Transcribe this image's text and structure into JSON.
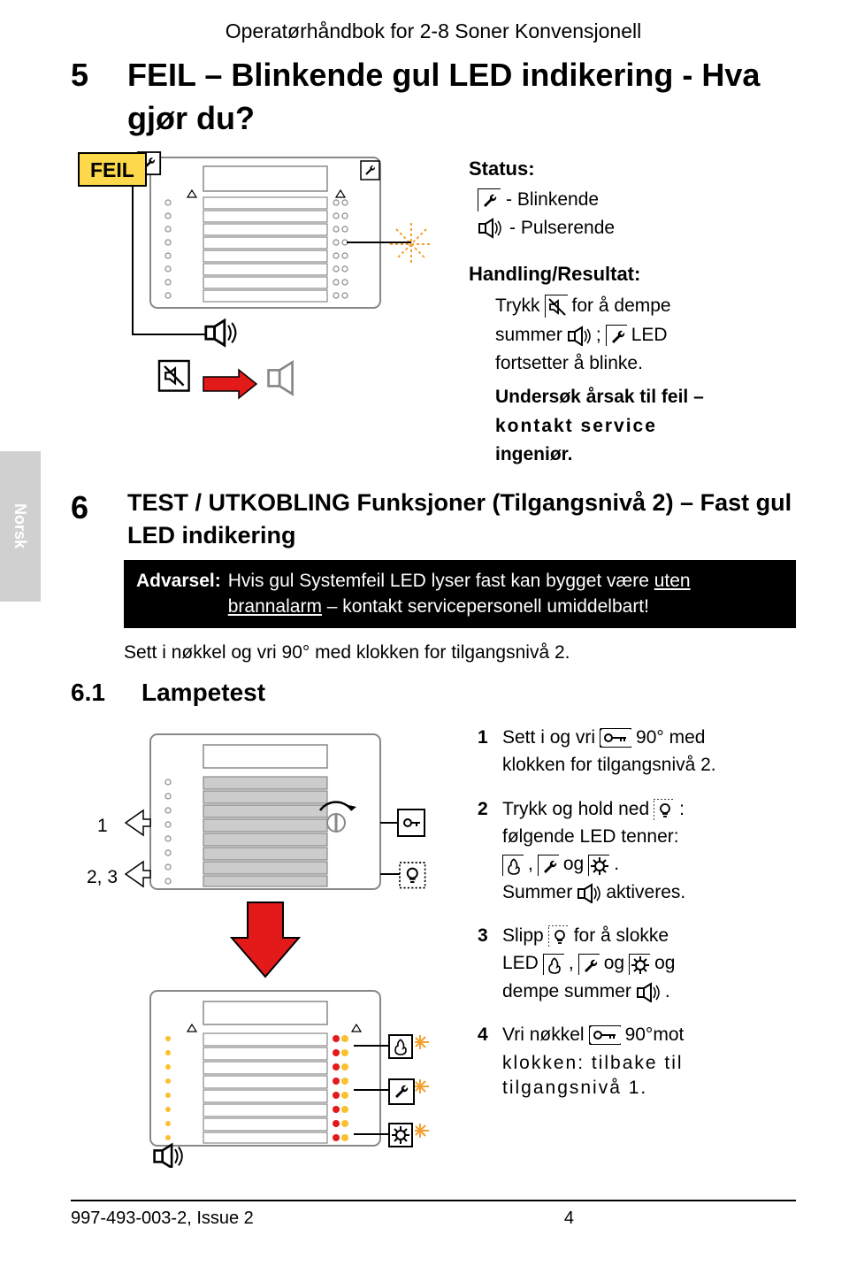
{
  "doc_title": "Operatørhåndbok for 2-8 Soner Konvensjonell",
  "sec5": {
    "num": "5",
    "title": "FEIL – Blinkende gul LED indikering - Hva gjør du?",
    "feil_badge": "FEIL",
    "status_hd": "Status:",
    "status_blink": " - Blinkende",
    "status_pulse": "- Pulserende",
    "handling_hd": "Handling/Resultat:",
    "a1_pre": "Trykk",
    "a1_mid": "for å dempe",
    "a2_pre": "summer",
    "a2_semi": ";",
    "a2_post": "LED",
    "a3": "fortsetter å blinke.",
    "investigate": "Undersøk årsak til feil –",
    "contact": "kontakt service",
    "engineer": "ingeniør."
  },
  "side_tab": "Norsk",
  "sec6": {
    "num": "6",
    "title": "TEST / UTKOBLING Funksjoner (Tilgangsnivå 2) – Fast gul LED indikering",
    "warn_label": "Advarsel:",
    "warn_text1": "Hvis gul Systemfeil LED lyser fast kan bygget være ",
    "warn_u": "uten brannalarm",
    "warn_text2": " – kontakt servicepersonell umiddelbart!",
    "insert_key": "Sett i nøkkel og vri 90° med klokken for tilgangsnivå 2."
  },
  "sec61": {
    "num": "6.1",
    "title": "Lampetest",
    "callout1": "1",
    "callout2": "2, 3",
    "step1_a": "Sett i og vri",
    "step1_b": "90° med",
    "step1_c": "klokken for tilgangsnivå 2.",
    "step2_a": "Trykk og hold ned",
    "step2_b": ":",
    "step2_c": "følgende LED tenner:",
    "step2_d": ",",
    "step2_e": "og",
    "step2_f": ".",
    "step2_g": "Summer",
    "step2_h": "aktiveres.",
    "step3_a": "Slipp",
    "step3_b": "for å slokke",
    "step3_c": "LED",
    "step3_d": ",",
    "step3_e": "og",
    "step3_f": "og",
    "step3_g": "dempe summer",
    "step3_h": ".",
    "step4_a": "Vri nøkkel",
    "step4_b": "90°mot",
    "step4_c": "klokken: tilbake til tilgangsnivå 1."
  },
  "footer": {
    "doc_id": "997-493-003-2, Issue 2",
    "page": "4"
  },
  "icons": {
    "wrench": "wrench-icon",
    "speaker": "speaker-icon",
    "mute": "mute-button-icon",
    "key": "key-icon",
    "fire": "fire-icon",
    "gear": "gear-icon",
    "lamp": "lamp-button-icon"
  }
}
